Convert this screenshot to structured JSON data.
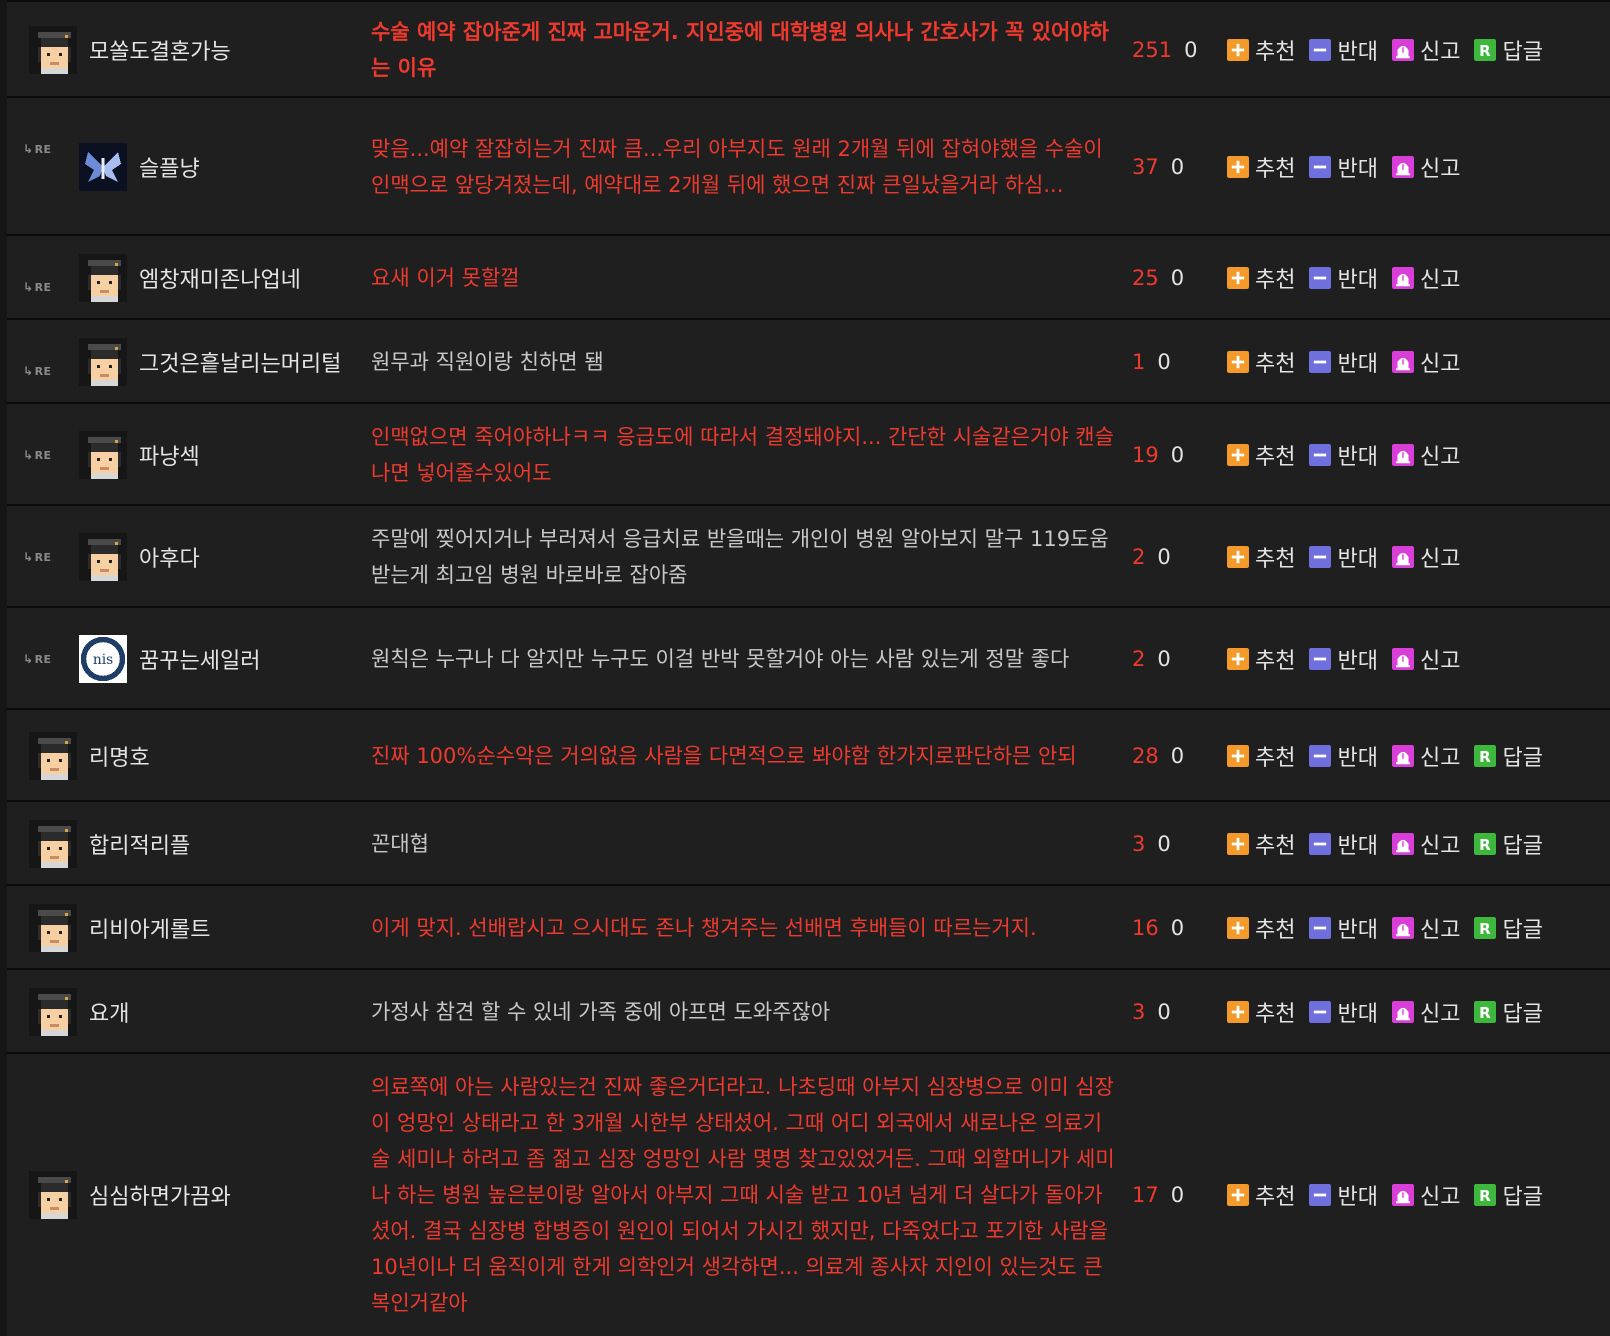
{
  "actions": {
    "up": "추천",
    "down": "반대",
    "report": "신고",
    "reply": "답글",
    "re_mark": "RE"
  },
  "colors": {
    "background": "#161616",
    "row": "#1f1f1f",
    "hot_text": "#ee3a2e",
    "up_icon": "#f39a2a",
    "down_icon": "#6f70dd",
    "report_icon": "#d93fd8",
    "reply_icon": "#3db83d"
  },
  "comments": [
    {
      "avatar": "grad-cap-icon",
      "name": "모쏠도결혼가능",
      "is_reply": false,
      "hot": true,
      "bold": true,
      "text": "수술 예약 잡아준게 진짜 고마운거. 지인중에 대학병원 의사나 간호사가 꼭 있어야하는 이유",
      "up": "251",
      "down": "0",
      "has_reply_btn": true
    },
    {
      "avatar": "butterfly-icon",
      "name": "슬플냥",
      "is_reply": true,
      "hot": true,
      "bold": false,
      "text": "맞음...예약 잘잡히는거 진짜 큼...우리 아부지도 원래 2개월 뒤에 잡혀야했을 수술이 인맥으로 앞당겨졌는데, 예약대로 2개월 뒤에 했으면 진짜 큰일났을거라 하심...",
      "up": "37",
      "down": "0",
      "has_reply_btn": false
    },
    {
      "avatar": "grad-cap-icon",
      "name": "엠창재미존나업네",
      "is_reply": true,
      "hot": true,
      "bold": false,
      "text": "요새 이거 못할껄",
      "up": "25",
      "down": "0",
      "has_reply_btn": false
    },
    {
      "avatar": "grad-cap-icon",
      "name": "그것은흩날리는머리털",
      "is_reply": true,
      "hot": false,
      "bold": false,
      "text": "원무과 직원이랑 친하면 됌",
      "up": "1",
      "down": "0",
      "has_reply_btn": false
    },
    {
      "avatar": "grad-cap-icon",
      "name": "파냥섹",
      "is_reply": true,
      "hot": true,
      "bold": false,
      "text": "인맥없으면 죽어야하나ㅋㅋ 응급도에 따라서 결정돼야지... 간단한 시술같은거야 캔슬나면 넣어줄수있어도",
      "up": "19",
      "down": "0",
      "has_reply_btn": false
    },
    {
      "avatar": "grad-cap-icon",
      "name": "아후다",
      "is_reply": true,
      "hot": false,
      "bold": false,
      "text": "주말에 찢어지거나 부러져서 응급치료 받을때는 개인이 병원 알아보지 말구 119도움 받는게 최고임 병원 바로바로 잡아줌",
      "up": "2",
      "down": "0",
      "has_reply_btn": false
    },
    {
      "avatar": "nis-seal-icon",
      "name": "꿈꾸는세일러",
      "is_reply": true,
      "hot": false,
      "bold": false,
      "text": "원칙은 누구나 다 알지만 누구도 이걸 반박 못할거야 아는 사람 있는게 정말 좋다",
      "up": "2",
      "down": "0",
      "has_reply_btn": false
    },
    {
      "avatar": "grad-cap-icon",
      "name": "리명호",
      "is_reply": false,
      "hot": true,
      "bold": false,
      "text": "진짜 100%순수악은 거의없음 사람을 다면적으로 봐야함 한가지로판단하믄 안되",
      "up": "28",
      "down": "0",
      "has_reply_btn": true
    },
    {
      "avatar": "grad-cap-icon",
      "name": "합리적리플",
      "is_reply": false,
      "hot": false,
      "bold": false,
      "text": "꼰대협",
      "up": "3",
      "down": "0",
      "has_reply_btn": true
    },
    {
      "avatar": "grad-cap-icon",
      "name": "리비아게롤트",
      "is_reply": false,
      "hot": true,
      "bold": false,
      "text": "이게 맞지. 선배랍시고 으시대도 존나 챙겨주는 선배면 후배들이 따르는거지.",
      "up": "16",
      "down": "0",
      "has_reply_btn": true
    },
    {
      "avatar": "grad-cap-icon",
      "name": "요개",
      "is_reply": false,
      "hot": false,
      "bold": false,
      "text": "가정사 참견 할 수 있네 가족 중에 아프면 도와주잖아",
      "up": "3",
      "down": "0",
      "has_reply_btn": true
    },
    {
      "avatar": "grad-cap-icon",
      "name": "심심하면가끔와",
      "is_reply": false,
      "hot": true,
      "bold": false,
      "text": "의료쪽에 아는 사람있는건 진짜 좋은거더라고. 나초딩때 아부지 심장병으로 이미 심장이 엉망인 상태라고 한 3개월 시한부 상태셨어. 그때 어디 외국에서 새로나온 의료기술 세미나 하려고 좀 젊고 심장 엉망인 사람 몇명 찾고있었거든. 그때 외할머니가 세미나 하는 병원 높은분이랑 알아서 아부지 그때 시술 받고 10년 넘게 더 살다가 돌아가셨어. 결국 심장병 합병증이 원인이 되어서 가시긴 했지만, 다죽었다고 포기한 사람을 10년이나 더 움직이게 한게 의학인거 생각하면... 의료계 종사자 지인이 있는것도 큰 복인거같아",
      "up": "17",
      "down": "0",
      "has_reply_btn": true
    }
  ]
}
